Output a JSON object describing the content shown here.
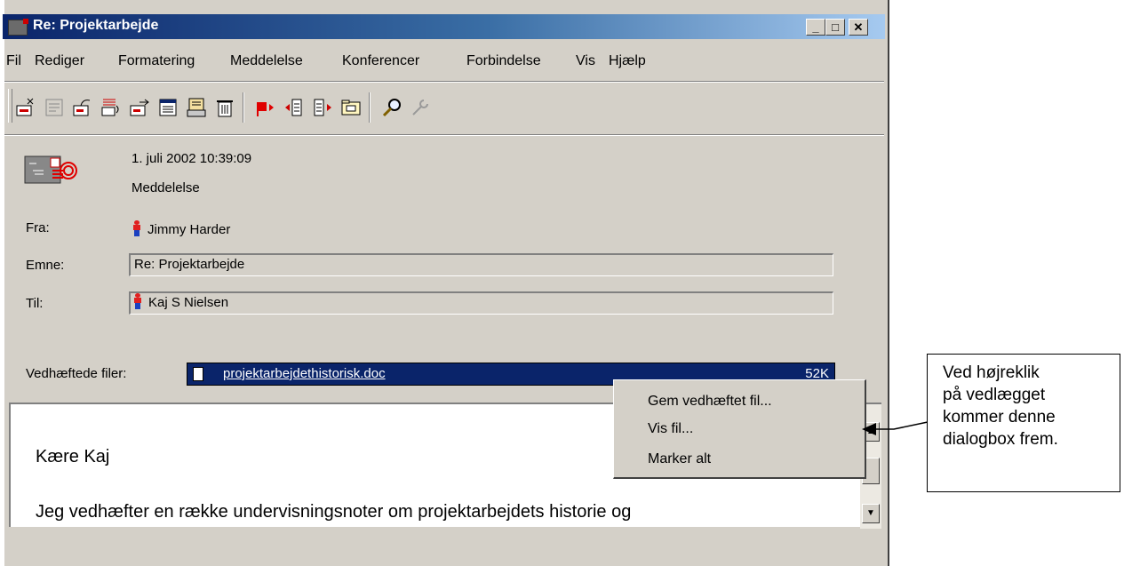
{
  "window": {
    "title": "Re: Projektarbejde",
    "controls": [
      "_",
      "□",
      "✕"
    ]
  },
  "menu": [
    "Fil",
    "Rediger",
    "Formatering",
    "Meddelelse",
    "Konferencer",
    "Forbindelse",
    "Vis",
    "Hjælp"
  ],
  "toolbar": {
    "icons": [
      "new-message-icon",
      "reply-icon",
      "reply-all-icon",
      "forward-icon",
      "send-icon",
      "print-icon",
      "delete-icon",
      "flag-icon",
      "previous-icon",
      "next-icon",
      "move-to-folder-icon",
      "find-icon",
      "tools-icon"
    ]
  },
  "message": {
    "date": "1. juli 2002 10:39:09",
    "type": "Meddelelse",
    "from_label": "Fra:",
    "from": "Jimmy Harder",
    "subject_label": "Emne:",
    "subject": "Re: Projektarbejde",
    "to_label": "Til:",
    "to": "Kaj S Nielsen",
    "attachments_label": "Vedhæftede filer:",
    "attachment_name": "projektarbejdethistorisk.doc",
    "attachment_size": "52K",
    "body": [
      "Kære Kaj",
      "Jeg vedhæfter en række undervisningsnoter om projektarbejdets historie og"
    ]
  },
  "context_menu": [
    "Gem vedhæftet fil...",
    "Vis fil...",
    "Marker alt"
  ],
  "callout": [
    "Ved højreklik",
    "på vedlægget",
    "kommer denne",
    "dialogbox frem."
  ],
  "colors": {
    "titlebar_start": "#0a246a",
    "titlebar_end": "#a6caf0",
    "selection": "#0a246a",
    "face": "#d4d0c8"
  }
}
